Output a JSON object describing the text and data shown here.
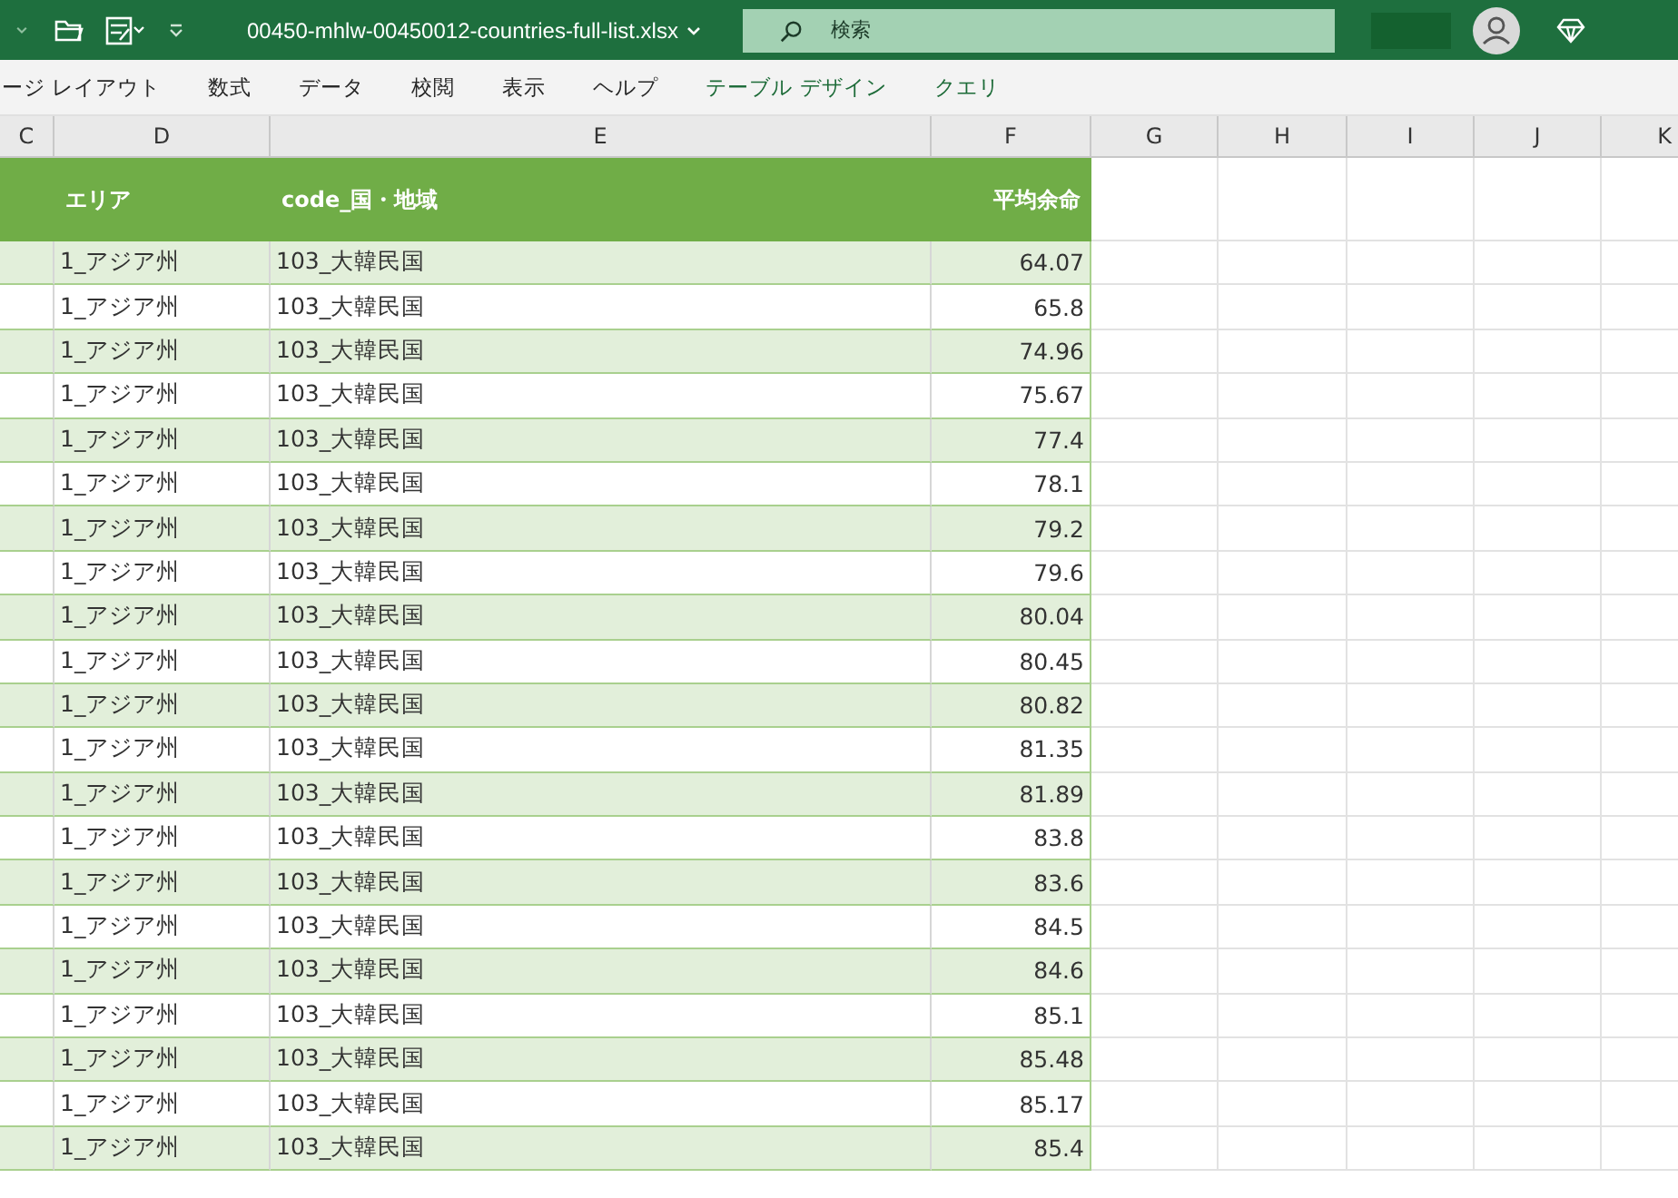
{
  "title_bar": {
    "filename": "00450-mhlw-00450012-countries-full-list.xlsx",
    "search": {
      "placeholder": "検索"
    }
  },
  "ribbon_tabs": [
    {
      "label": "ージ レイアウト",
      "kind": "normal"
    },
    {
      "label": "数式",
      "kind": "normal"
    },
    {
      "label": "データ",
      "kind": "normal"
    },
    {
      "label": "校閲",
      "kind": "normal"
    },
    {
      "label": "表示",
      "kind": "normal"
    },
    {
      "label": "ヘルプ",
      "kind": "normal"
    },
    {
      "label": "テーブル デザイン",
      "kind": "contextual"
    },
    {
      "label": "クエリ",
      "kind": "contextual"
    }
  ],
  "column_headers": [
    "C",
    "D",
    "E",
    "F",
    "G",
    "H",
    "I",
    "J",
    "K"
  ],
  "table": {
    "columns": [
      "エリア",
      "code_国・地域",
      "平均余命"
    ],
    "rows": [
      {
        "area": "1_アジア州",
        "country": "103_大韓民国",
        "value": "64.07"
      },
      {
        "area": "1_アジア州",
        "country": "103_大韓民国",
        "value": "65.8"
      },
      {
        "area": "1_アジア州",
        "country": "103_大韓民国",
        "value": "74.96"
      },
      {
        "area": "1_アジア州",
        "country": "103_大韓民国",
        "value": "75.67"
      },
      {
        "area": "1_アジア州",
        "country": "103_大韓民国",
        "value": "77.4"
      },
      {
        "area": "1_アジア州",
        "country": "103_大韓民国",
        "value": "78.1"
      },
      {
        "area": "1_アジア州",
        "country": "103_大韓民国",
        "value": "79.2"
      },
      {
        "area": "1_アジア州",
        "country": "103_大韓民国",
        "value": "79.6"
      },
      {
        "area": "1_アジア州",
        "country": "103_大韓民国",
        "value": "80.04"
      },
      {
        "area": "1_アジア州",
        "country": "103_大韓民国",
        "value": "80.45"
      },
      {
        "area": "1_アジア州",
        "country": "103_大韓民国",
        "value": "80.82"
      },
      {
        "area": "1_アジア州",
        "country": "103_大韓民国",
        "value": "81.35"
      },
      {
        "area": "1_アジア州",
        "country": "103_大韓民国",
        "value": "81.89"
      },
      {
        "area": "1_アジア州",
        "country": "103_大韓民国",
        "value": "83.8"
      },
      {
        "area": "1_アジア州",
        "country": "103_大韓民国",
        "value": "83.6"
      },
      {
        "area": "1_アジア州",
        "country": "103_大韓民国",
        "value": "84.5"
      },
      {
        "area": "1_アジア州",
        "country": "103_大韓民国",
        "value": "84.6"
      },
      {
        "area": "1_アジア州",
        "country": "103_大韓民国",
        "value": "85.1"
      },
      {
        "area": "1_アジア州",
        "country": "103_大韓民国",
        "value": "85.48"
      },
      {
        "area": "1_アジア州",
        "country": "103_大韓民国",
        "value": "85.17"
      },
      {
        "area": "1_アジア州",
        "country": "103_大韓民国",
        "value": "85.4"
      }
    ]
  }
}
